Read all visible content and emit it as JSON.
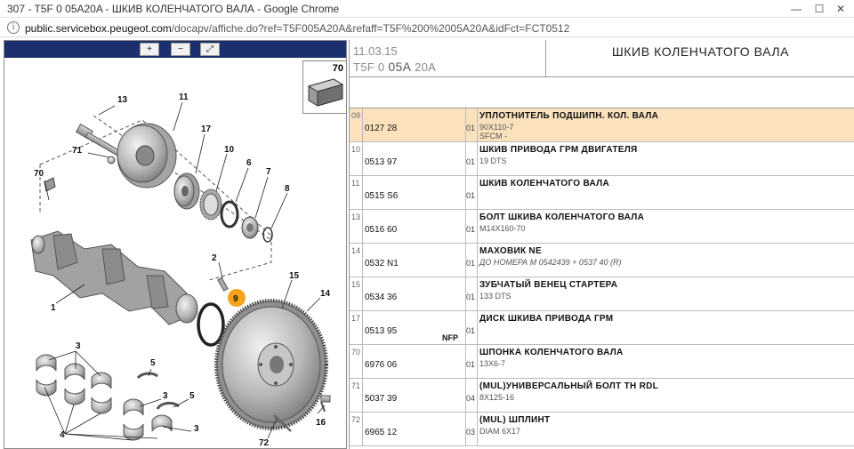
{
  "window": {
    "title": "307 - T5F 0 05A20A - ШКИВ КОЛЕНЧАТОГО ВАЛА - Google Chrome",
    "minimize": "—",
    "maximize": "☐",
    "close": "✕"
  },
  "address": {
    "info_icon": "i",
    "host": "public.servicebox.peugeot.com",
    "path": "/docapv/affiche.do?ref=T5F005A20A&refaff=T5F%200%2005A20A&idFct=FCT0512"
  },
  "toolbar": {
    "zoom_in": "+",
    "zoom_out": "−",
    "zoom_fit": "⤢"
  },
  "thumbnail": {
    "number": "70"
  },
  "diagram": {
    "labels": [
      "13",
      "11",
      "71",
      "17",
      "10",
      "6",
      "7",
      "8",
      "70",
      "2",
      "9",
      "1",
      "15",
      "14",
      "3",
      "5",
      "3",
      "5",
      "3",
      "4",
      "16",
      "72"
    ],
    "highlight_color": "#f5a21f"
  },
  "header": {
    "date": "11.03.15",
    "code_prefix": "T5F 0",
    "code_mid": "05A",
    "code_suffix": "20A",
    "title": "ШКИВ КОЛЕНЧАТОГО ВАЛА"
  },
  "parts": [
    {
      "ref": "09",
      "part": "0127 28",
      "qty": "01",
      "name": "УПЛОТНИТЕЛЬ ПОДШИПН. КОЛ. ВАЛА",
      "note": "90X110-7",
      "note2": "SFCM -",
      "highlight": true
    },
    {
      "ref": "10",
      "part": "0513 97",
      "qty": "01",
      "name": "ШКИВ ПРИВОДА ГРМ ДВИГАТЕЛЯ",
      "note": "19 DTS"
    },
    {
      "ref": "11",
      "part": "0515 S6",
      "qty": "01",
      "name": "ШКИВ КОЛЕНЧАТОГО ВАЛА",
      "note": ""
    },
    {
      "ref": "13",
      "part": "0516 60",
      "qty": "01",
      "name": "БОЛТ ШКИВА КОЛЕНЧАТОГО ВАЛА",
      "note": "M14X160-70"
    },
    {
      "ref": "14",
      "part": "0532 N1",
      "qty": "01",
      "name": "МАХОВИК NE",
      "note": "ДО НОМЕРА M 0542439 + 0537 40 (R)",
      "italic": true
    },
    {
      "ref": "15",
      "part": "0534 36",
      "qty": "01",
      "name": "ЗУБЧАТЫЙ ВЕНЕЦ СТАРТЕРА",
      "note": "133 DTS"
    },
    {
      "ref": "17",
      "part": "0513 95",
      "qty": "01",
      "name": "ДИСК ШКИВА ПРИВОДА ГРМ",
      "note": "",
      "nfp": "NFP"
    },
    {
      "ref": "70",
      "part": "6976 06",
      "qty": "01",
      "name": "ШПОНКА КОЛЕНЧАТОГО ВАЛА",
      "note": "13X6-7"
    },
    {
      "ref": "71",
      "part": "5037 39",
      "qty": "04",
      "name": "(MUL)УНИВЕРСАЛЬНЫЙ БОЛТ TH RDL",
      "note": "8X125-16"
    },
    {
      "ref": "72",
      "part": "6965 12",
      "qty": "03",
      "name": "(MUL) ШПЛИНТ",
      "note": "DIAM 6X17"
    }
  ]
}
